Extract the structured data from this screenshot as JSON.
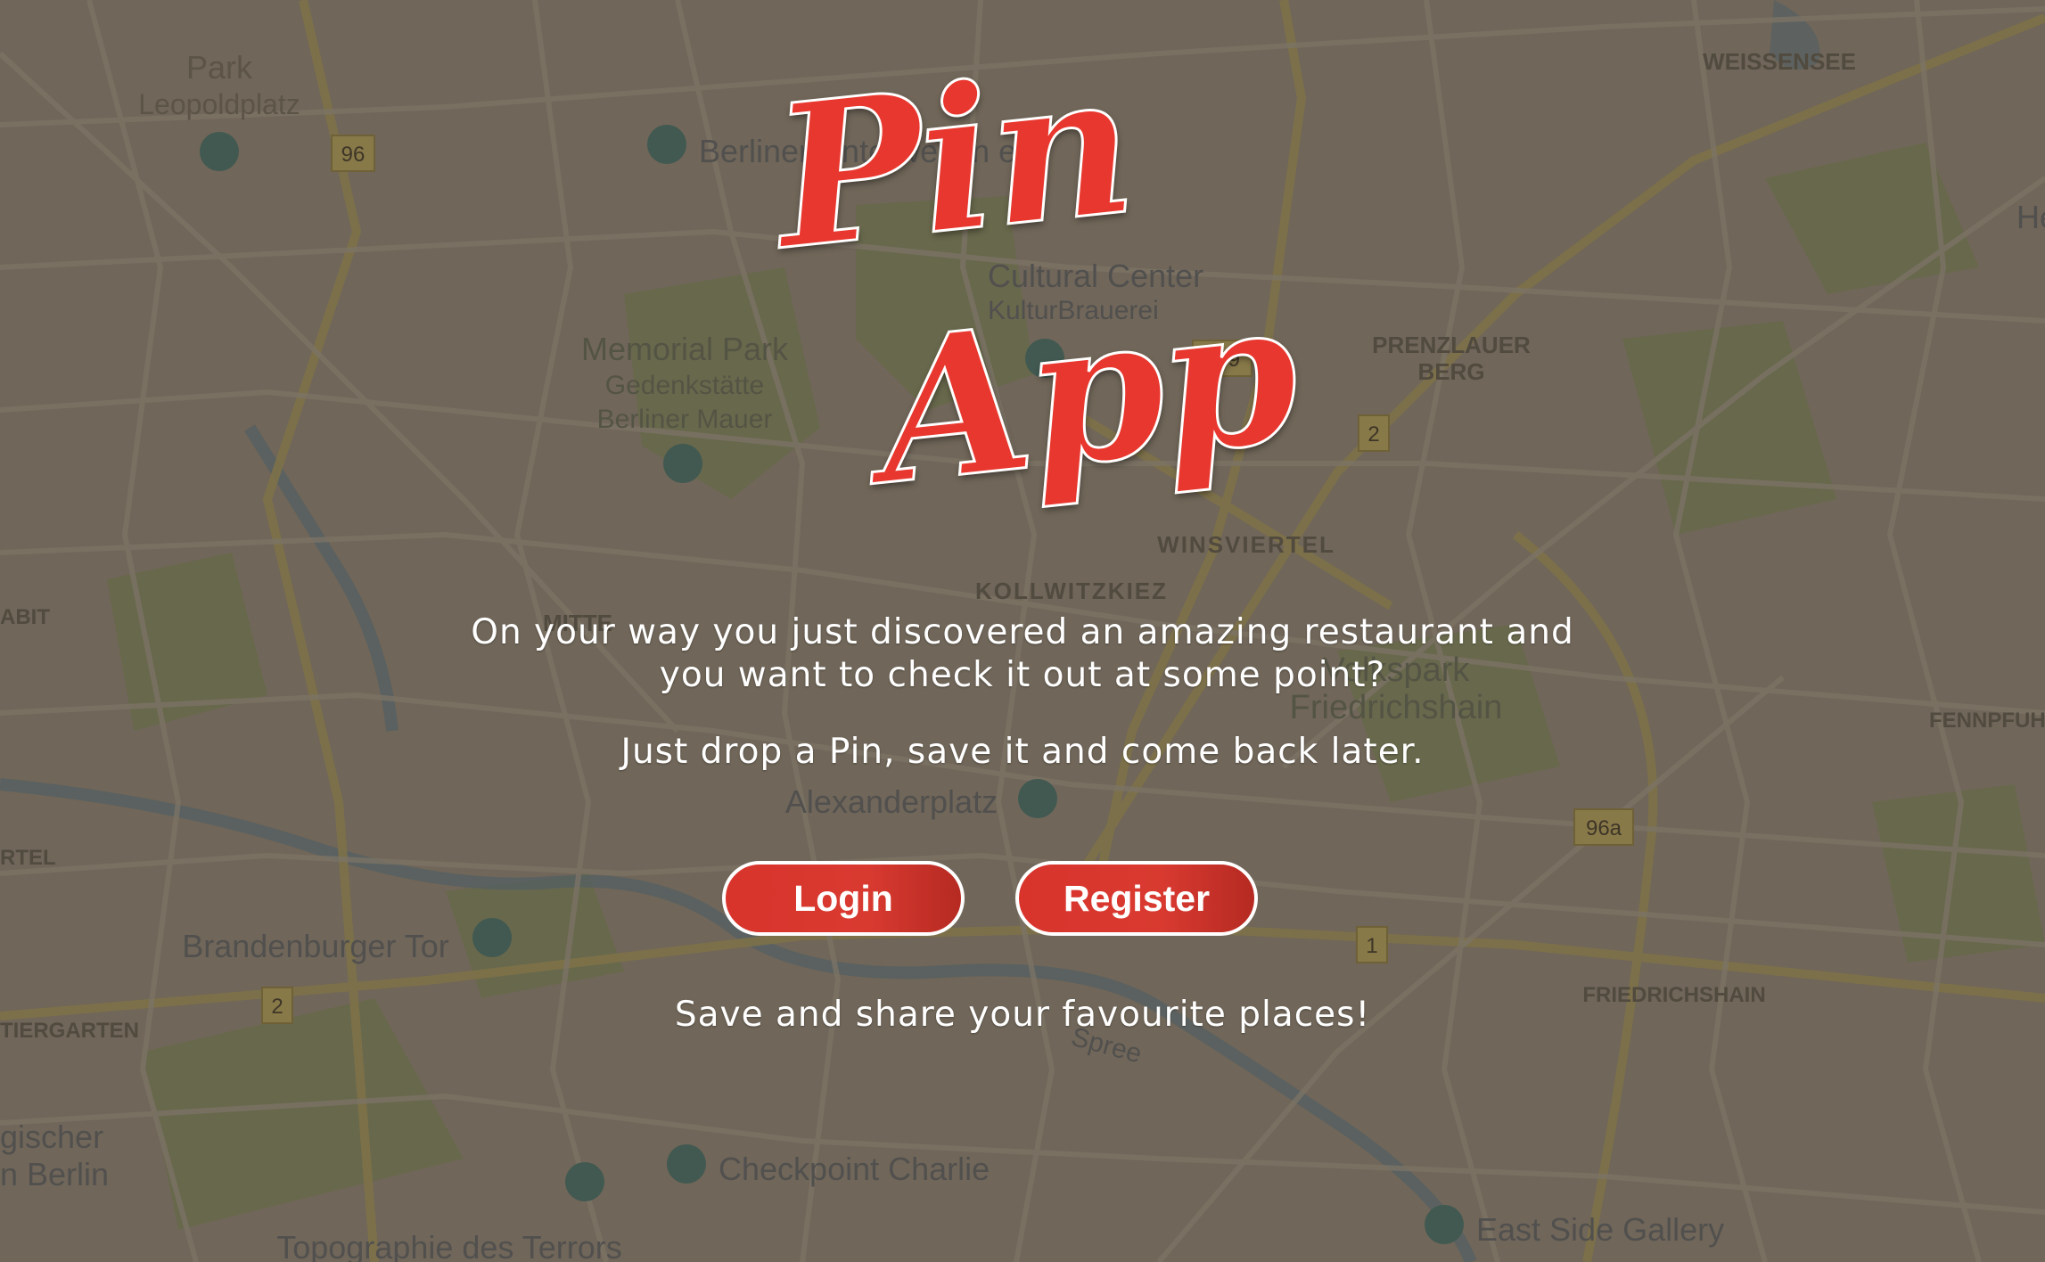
{
  "app": {
    "logo_word_1": "Pin",
    "logo_word_2": "App",
    "brand_color": "#e8372e"
  },
  "intro": {
    "line_1": "On your way you just discovered an amazing restaurant and",
    "line_2": "you want to check it out at some point?",
    "line_3": "Just drop a Pin, save it and come back later.",
    "closing": "Save and share your favourite places!"
  },
  "actions": {
    "login_label": "Login",
    "register_label": "Register"
  },
  "map": {
    "labels": {
      "park": "Park",
      "leopoldplatz": "Leopoldplatz",
      "berlin_unterwelten": "Berliner Unterwelten e.V",
      "cultural_center": "Cultural Center",
      "kulturbrauerei": "KulturBrauerei",
      "memorial_park": "Memorial Park",
      "gedenkstaette": "Gedenkstätte",
      "berliner_mauer": "Berliner Mauer",
      "prenzlauer": "PRENZLAUER",
      "berg": "BERG",
      "weissensee": "WEISSENSEE",
      "winsviertel": "WINSVIERTEL",
      "kollwitzkiez": "KOLLWITZKIEZ",
      "mitte": "MITTE",
      "volkspark": "Volkspark",
      "friedrichshain_park": "Friedrichshain",
      "fennpfuhl": "FENNPFUHL",
      "alexanderplatz": "Alexanderplatz",
      "brandenburger_tor": "Brandenburger Tor",
      "tiergarten": "TIERGARTEN",
      "friedrichshain": "FRIEDRICHSHAIN",
      "checkpoint_charlie": "Checkpoint Charlie",
      "east_side_gallery": "East Side Gallery",
      "topographie": "Topographie des Terrors",
      "gischer": "gischer",
      "n_berlin": "n Berlin",
      "abit": "ABIT",
      "rtel": "RTEL",
      "he": "He",
      "spree": "Spree"
    },
    "road_numbers": {
      "r96": "96",
      "r109": "109",
      "r2_north": "2",
      "r2_west": "2",
      "r96a": "96a",
      "r1": "1"
    }
  }
}
